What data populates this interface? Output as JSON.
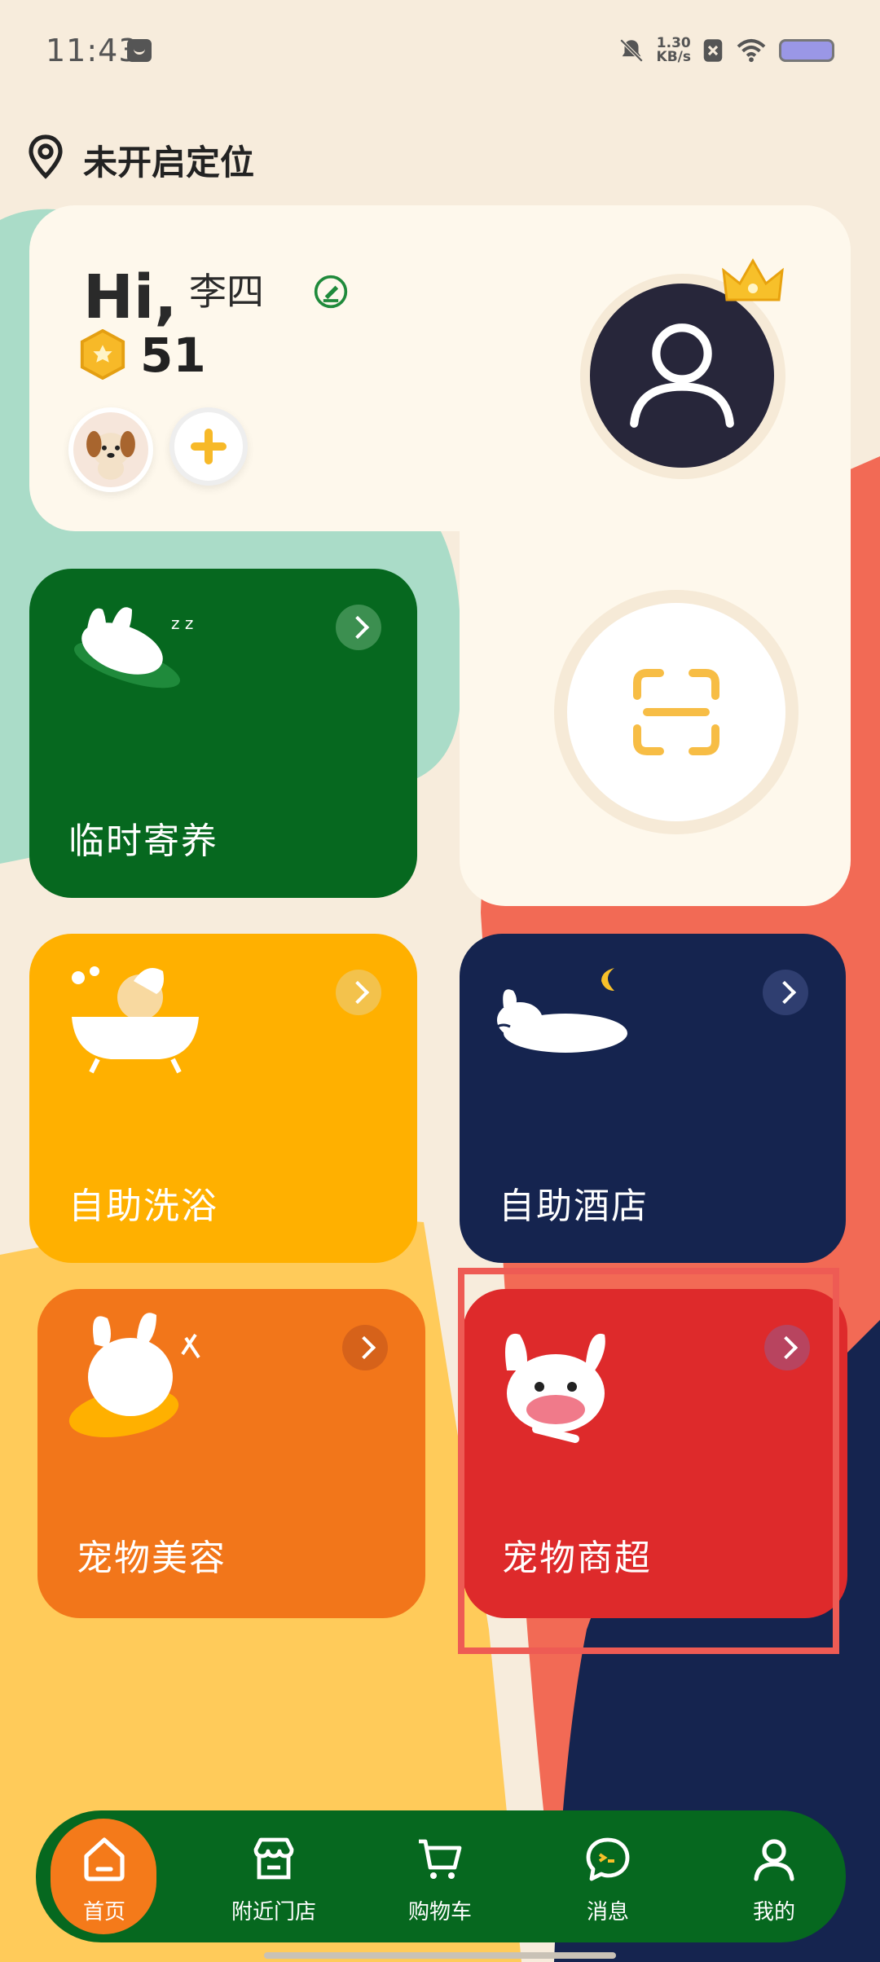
{
  "status_bar": {
    "time": "11:43",
    "net_speed_value": "1.30",
    "net_speed_unit": "KB/s",
    "battery_color": "#9a97e6"
  },
  "location": {
    "label": "未开启定位",
    "icon": "location-pin-icon"
  },
  "profile": {
    "greeting": "Hi,",
    "name": "李四",
    "points": "51",
    "edit_icon": "edit-icon",
    "coin_icon": "coin-icon",
    "pet_avatar_icon": "dog-avatar",
    "add_pet_icon": "plus-icon",
    "avatar_icon": "user-icon",
    "crown_icon": "crown-icon",
    "scan_icon": "scan-icon"
  },
  "services": [
    {
      "label": "临时寄养",
      "color": "#06681f",
      "arrow_color": "#3c8f50",
      "illustration": "sleeping-dog"
    },
    {
      "label": "自助洗浴",
      "color": "#ffb000",
      "arrow_color": "#f3c24c",
      "illustration": "dog-in-bathtub"
    },
    {
      "label": "自助酒店",
      "color": "#15244f",
      "arrow_color": "#2f3e70",
      "illustration": "dog-sleeping-moon"
    },
    {
      "label": "宠物美容",
      "color": "#f2761a",
      "arrow_color": "#d6621a",
      "illustration": "dog-grooming"
    },
    {
      "label": "宠物商超",
      "color": "#de2a2b",
      "arrow_color": "#b8445f",
      "illustration": "dog-with-bone"
    }
  ],
  "bottom_nav": [
    {
      "label": "首页",
      "icon": "home-icon",
      "active": true
    },
    {
      "label": "附近门店",
      "icon": "store-icon",
      "active": false
    },
    {
      "label": "购物车",
      "icon": "cart-icon",
      "active": false
    },
    {
      "label": "消息",
      "icon": "message-icon",
      "active": false
    },
    {
      "label": "我的",
      "icon": "profile-icon",
      "active": false
    }
  ],
  "colors": {
    "background": "#f7ecdc",
    "card_bg": "#fef8ec",
    "nav_bg": "#06681f",
    "nav_active": "#f47a1a",
    "highlight": "#ee5b54"
  }
}
